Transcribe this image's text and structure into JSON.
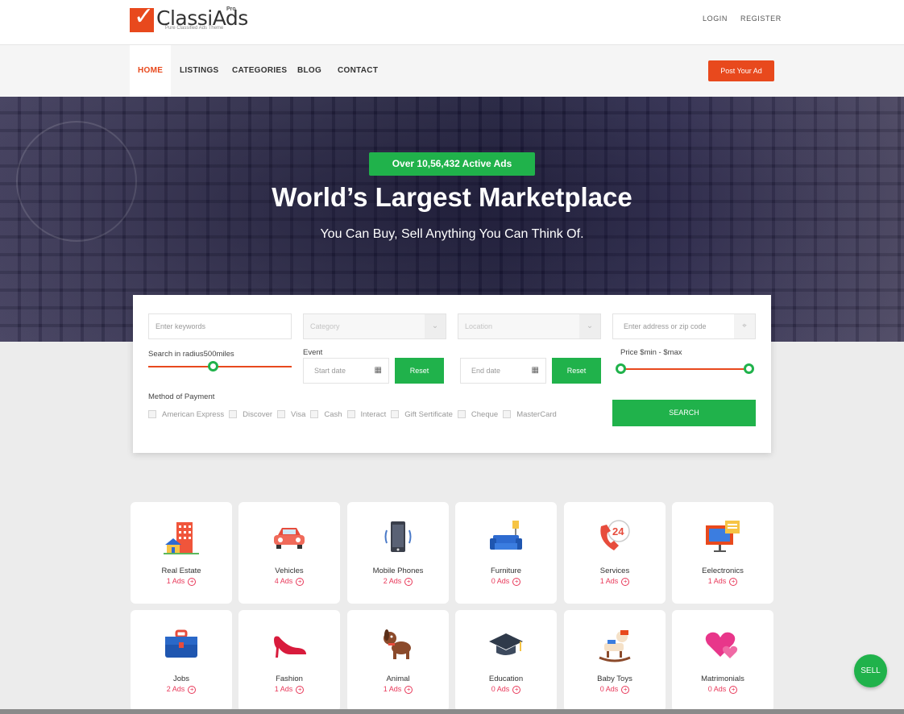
{
  "brand": {
    "name": "ClassiAds",
    "badge": "Pro",
    "tagline": "Pure Classified Ads Theme"
  },
  "auth": {
    "login": "LOGIN",
    "register": "REGISTER"
  },
  "nav": {
    "home": "HOME",
    "listings": "LISTINGS",
    "categories": "CATEGORIES",
    "blog": "BLOG",
    "contact": "CONTACT",
    "post_ad": "Post Your Ad"
  },
  "hero": {
    "badge": "Over 10,56,432 Active Ads",
    "title": "World’s Largest Marketplace",
    "subtitle": "You Can Buy, Sell Anything You Can Think Of."
  },
  "search": {
    "keywords_placeholder": "Enter keywords",
    "category_placeholder": "Category",
    "location_placeholder": "Location",
    "address_placeholder": "Enter address or zip code",
    "radius_label": "Search in radius500miles",
    "radius_fraction": 0.45,
    "event_label": "Event",
    "start_date": "Start date",
    "end_date": "End date",
    "reset": "Reset",
    "price_label": "Price $min - $max",
    "payment_label": "Method of Payment",
    "payment_methods": [
      "American Express",
      "Discover",
      "Visa",
      "Cash",
      "Interact",
      "Gift Sertificate",
      "Cheque",
      "MasterCard"
    ],
    "search_button": "SEARCH"
  },
  "categories": [
    {
      "name": "Real Estate",
      "ads": "1 Ads",
      "icon": "building-icon"
    },
    {
      "name": "Vehicles",
      "ads": "4 Ads",
      "icon": "car-icon"
    },
    {
      "name": "Mobile Phones",
      "ads": "2 Ads",
      "icon": "phone-icon"
    },
    {
      "name": "Furniture",
      "ads": "0 Ads",
      "icon": "sofa-icon"
    },
    {
      "name": "Services",
      "ads": "1 Ads",
      "icon": "service-24-icon"
    },
    {
      "name": "Eelectronics",
      "ads": "1 Ads",
      "icon": "monitor-icon"
    },
    {
      "name": "Jobs",
      "ads": "2 Ads",
      "icon": "briefcase-icon"
    },
    {
      "name": "Fashion",
      "ads": "1 Ads",
      "icon": "heel-shoe-icon"
    },
    {
      "name": "Animal",
      "ads": "1 Ads",
      "icon": "dog-icon"
    },
    {
      "name": "Education",
      "ads": "0 Ads",
      "icon": "graduation-cap-icon"
    },
    {
      "name": "Baby Toys",
      "ads": "0 Ads",
      "icon": "rocking-horse-icon"
    },
    {
      "name": "Matrimonials",
      "ads": "0 Ads",
      "icon": "hearts-icon"
    }
  ],
  "sell_button": "SELL",
  "colors": {
    "accent": "#e8491d",
    "green": "#20b24b",
    "ads_pink": "#e8395a"
  }
}
